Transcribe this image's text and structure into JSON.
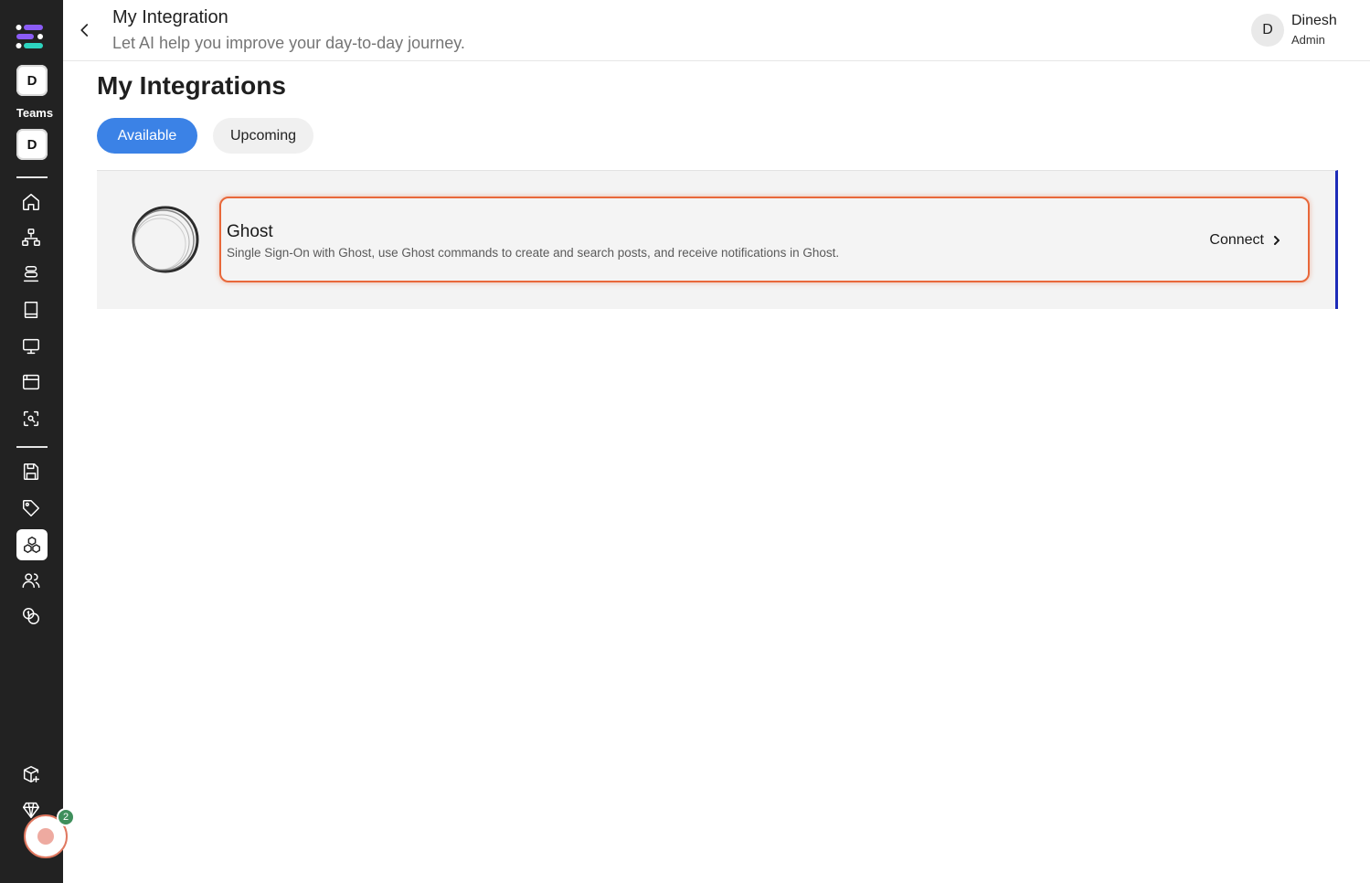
{
  "sidebar": {
    "workspace_initial": "D",
    "teams_label": "Teams",
    "team_initial": "D",
    "nav_icons": [
      "home-icon",
      "hierarchy-icon",
      "database-icon",
      "book-icon",
      "monitor-icon",
      "browser-icon",
      "scan-search-icon",
      "save-icon",
      "tag-icon",
      "integrations-icon",
      "users-icon",
      "coins-icon",
      "package-plus-icon",
      "diamond-icon"
    ],
    "active_item": "integrations-icon",
    "notification_count": "2"
  },
  "header": {
    "title": "My Integration",
    "subtitle": "Let AI help you improve your day-to-day journey.",
    "user": {
      "initial": "D",
      "name": "Dinesh",
      "role": "Admin"
    }
  },
  "main": {
    "section_title": "My Integrations",
    "tabs": [
      {
        "label": "Available",
        "active": true
      },
      {
        "label": "Upcoming",
        "active": false
      }
    ],
    "integrations": [
      {
        "name": "Ghost",
        "description": "Single Sign-On with Ghost, use Ghost commands to create and search posts, and receive notifications in Ghost.",
        "action_label": "Connect"
      }
    ]
  },
  "colors": {
    "sidebar_bg": "#222222",
    "accent_blue": "#3b82e6",
    "highlight_orange": "#e8683a",
    "panel_border": "#1d2bb8",
    "badge_green": "#3f8f5c"
  }
}
